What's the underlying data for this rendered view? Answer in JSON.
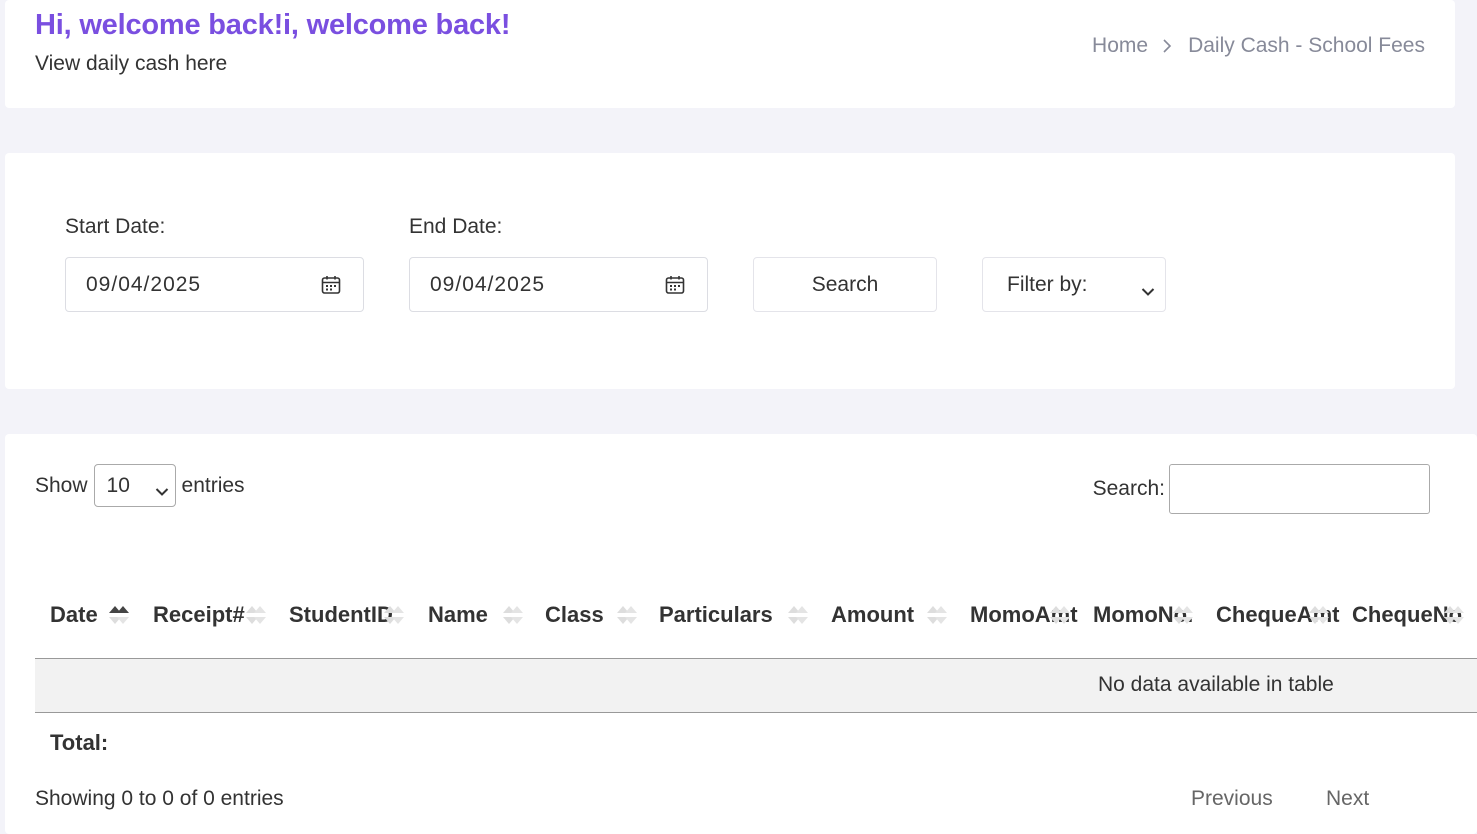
{
  "header": {
    "welcome": "Hi, welcome back!i, welcome back!",
    "subtitle": "View daily cash here",
    "breadcrumb": [
      "Home",
      "Daily Cash - School Fees"
    ]
  },
  "filters": {
    "start_label": "Start Date:",
    "start_value": "09/04/2025",
    "end_label": "End Date:",
    "end_value": "09/04/2025",
    "search_button": "Search",
    "filter_by": "Filter by:"
  },
  "table": {
    "show_label": "Show",
    "page_length": "10",
    "entries_label": "entries",
    "search_label": "Search:",
    "columns": [
      [
        "Date"
      ],
      [
        "Receipt",
        "#"
      ],
      [
        "Student",
        "ID"
      ],
      [
        "Name"
      ],
      [
        "Class"
      ],
      [
        "Particulars"
      ],
      [
        "Amount"
      ],
      [
        "Momo",
        "Amt"
      ],
      [
        "Momo",
        "No."
      ],
      [
        "Cheque",
        "Amt"
      ],
      [
        "Cheque",
        "No"
      ]
    ],
    "sorted_column": "Date",
    "empty_message": "No data available in table",
    "total_label": "Total:",
    "info": "Showing 0 to 0 of 0 entries",
    "previous": "Previous",
    "next": "Next"
  },
  "colors": {
    "accent": "#7a4fe0",
    "page_bg": "#f3f3f9",
    "muted_text": "#878a99"
  },
  "icons": [
    "calendar-icon",
    "chevron-right-icon",
    "chevron-down-icon",
    "sort-icon"
  ]
}
